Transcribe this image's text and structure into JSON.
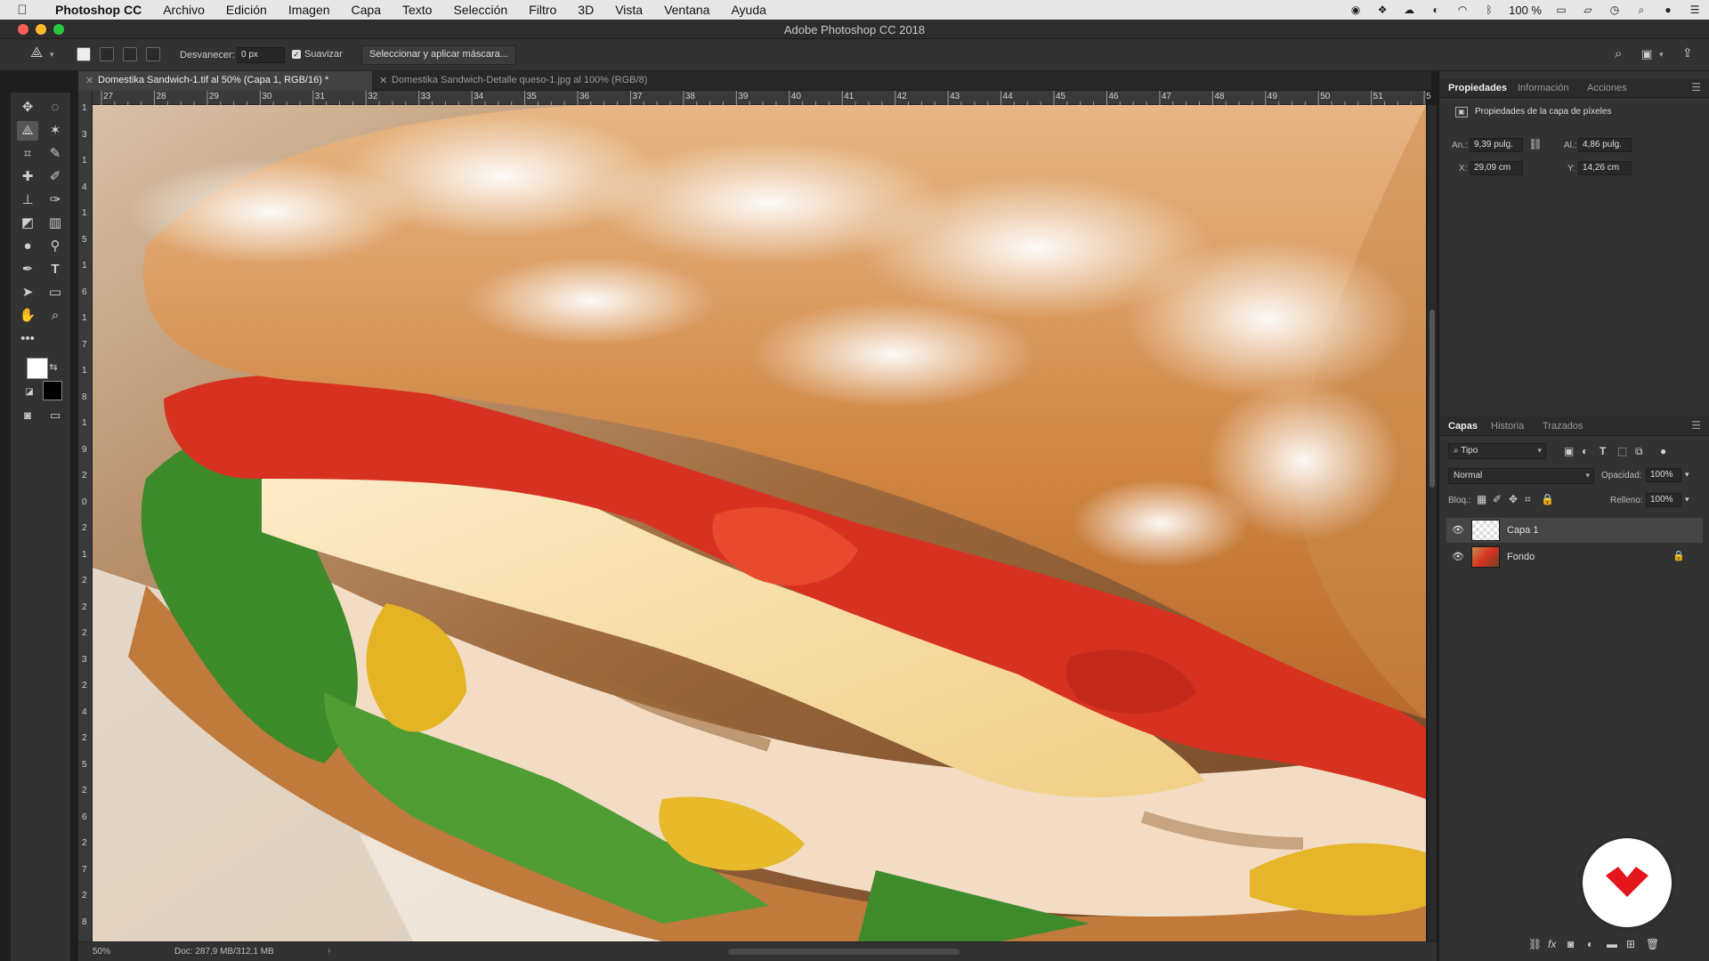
{
  "menubar": {
    "items": [
      "Photoshop CC",
      "Archivo",
      "Edición",
      "Imagen",
      "Capa",
      "Texto",
      "Selección",
      "Filtro",
      "3D",
      "Vista",
      "Ventana",
      "Ayuda"
    ],
    "battery": "100 %"
  },
  "window": {
    "title": "Adobe Photoshop CC 2018"
  },
  "options": {
    "feather_label": "Desvanecer:",
    "feather_value": "0 px",
    "antialias_label": "Suavizar",
    "mask_button": "Seleccionar y aplicar máscara..."
  },
  "tabs": [
    {
      "label": "Domestika Sandwich-1.tif al 50% (Capa 1, RGB/16) *",
      "active": true
    },
    {
      "label": "Domestika Sandwich-Detalle queso-1.jpg al 100% (RGB/8)",
      "active": false
    }
  ],
  "rulers": {
    "top": [
      "27",
      "28",
      "29",
      "30",
      "31",
      "32",
      "33",
      "34",
      "35",
      "36",
      "37",
      "38",
      "39",
      "40",
      "41",
      "42",
      "43",
      "44",
      "45",
      "46",
      "47",
      "48",
      "49",
      "50",
      "51",
      "5"
    ],
    "left": [
      "1",
      "3",
      "1",
      "4",
      "1",
      "5",
      "1",
      "6",
      "1",
      "7",
      "1",
      "8",
      "1",
      "9",
      "2",
      "0",
      "2",
      "1",
      "2",
      "2",
      "2",
      "3",
      "2",
      "4",
      "2",
      "5",
      "2",
      "6",
      "2",
      "7",
      "2",
      "8"
    ]
  },
  "status": {
    "zoom": "50%",
    "doc": "Doc: 287,9 MB/312,1 MB",
    "arrow": "›"
  },
  "properties": {
    "tabs": [
      "Propiedades",
      "Información",
      "Acciones"
    ],
    "header": "Propiedades de la capa de píxeles",
    "w_label": "An.:",
    "w_value": "9,39 pulg.",
    "h_label": "Al.:",
    "h_value": "4,86 pulg.",
    "x_label": "X:",
    "x_value": "29,09 cm",
    "y_label": "Y:",
    "y_value": "14,26 cm"
  },
  "layers": {
    "tabs": [
      "Capas",
      "Historia",
      "Trazados"
    ],
    "filter": "Tipo",
    "blend": "Normal",
    "opacity_label": "Opacidad:",
    "opacity": "100%",
    "lock_label": "Bloq.:",
    "fill_label": "Relleno:",
    "fill": "100%",
    "items": [
      {
        "name": "Capa 1",
        "selected": true,
        "locked": false
      },
      {
        "name": "Fondo",
        "selected": false,
        "locked": true
      }
    ]
  },
  "colors": {
    "accent_red": "#e4161c",
    "panel_bg": "#323232",
    "canvas_bg": "#1e1e1e"
  }
}
